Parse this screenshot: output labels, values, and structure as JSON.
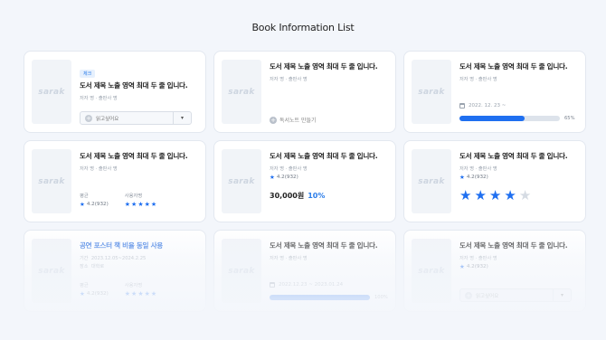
{
  "page": {
    "title": "Book Information List"
  },
  "thumb_logo": "sarak",
  "cards": [
    {
      "badge": "체크",
      "title": "도서 제목 노출 영역 최대 두 줄 입니다.",
      "meta": "저자 명 · 출판사 명",
      "select_label": "읽고싶어요",
      "select_arrow": "▾"
    },
    {
      "title": "도서 제목 노출 영역 최대 두 줄 입니다.",
      "meta": "저자 명 · 출판사 명",
      "note_button": "독서노트 만들기"
    },
    {
      "title": "도서 제목 노출 영역 최대 두 줄 입니다.",
      "meta": "저자 명 · 출판사 명",
      "date": "2022. 12. 23 ~",
      "progress_label": "65%",
      "progress_value": 65
    },
    {
      "title": "도서 제목 노출 영역 최대 두 줄 입니다.",
      "meta": "저자 명 · 출판사 명",
      "avg_label": "평균",
      "avg_value": "4.2(932)",
      "my_label": "사용자명",
      "my_stars": 5
    },
    {
      "title": "도서 제목 노출 영역 최대 두 줄 입니다.",
      "meta": "저자 명 · 출판사 명",
      "rating_value": "4.2(932)",
      "price": "30,000원",
      "discount": "10%"
    },
    {
      "title": "도서 제목 노출 영역 최대 두 줄 입니다.",
      "meta": "저자 명 · 출판사 명",
      "rating_value": "4.2(932)",
      "big_stars_on": 4,
      "big_stars_total": 5
    },
    {
      "title": "공연 포스터 책 비율 동일 사용",
      "period_label": "기간",
      "period_value": "2023.12.05~2024.2.25",
      "place_label": "장소",
      "place_value": "대학로",
      "avg_label": "평균",
      "avg_value": "4.2(932)",
      "my_label": "사용자명",
      "my_stars": 5
    },
    {
      "title": "도서 제목 노출 영역 최대 두 줄 입니다.",
      "meta": "저자 명 · 출판사 명",
      "date": "2022.12.23 ~ 2023.01.24",
      "progress_label": "100%",
      "progress_value": 100
    },
    {
      "title": "도서 제목 노출 영역 최대 두 줄 입니다.",
      "meta": "저자 명 · 출판사 명",
      "rating_value": "4.2(932)",
      "select_label": "읽고싶어요",
      "select_arrow": "▾"
    }
  ],
  "colors": {
    "accent": "#1f6ff0",
    "background": "#f3f6fb",
    "card_border": "#e3e8f0"
  },
  "icons": {
    "star": "star-icon",
    "calendar": "calendar-icon",
    "plus": "plus-circle-icon"
  }
}
